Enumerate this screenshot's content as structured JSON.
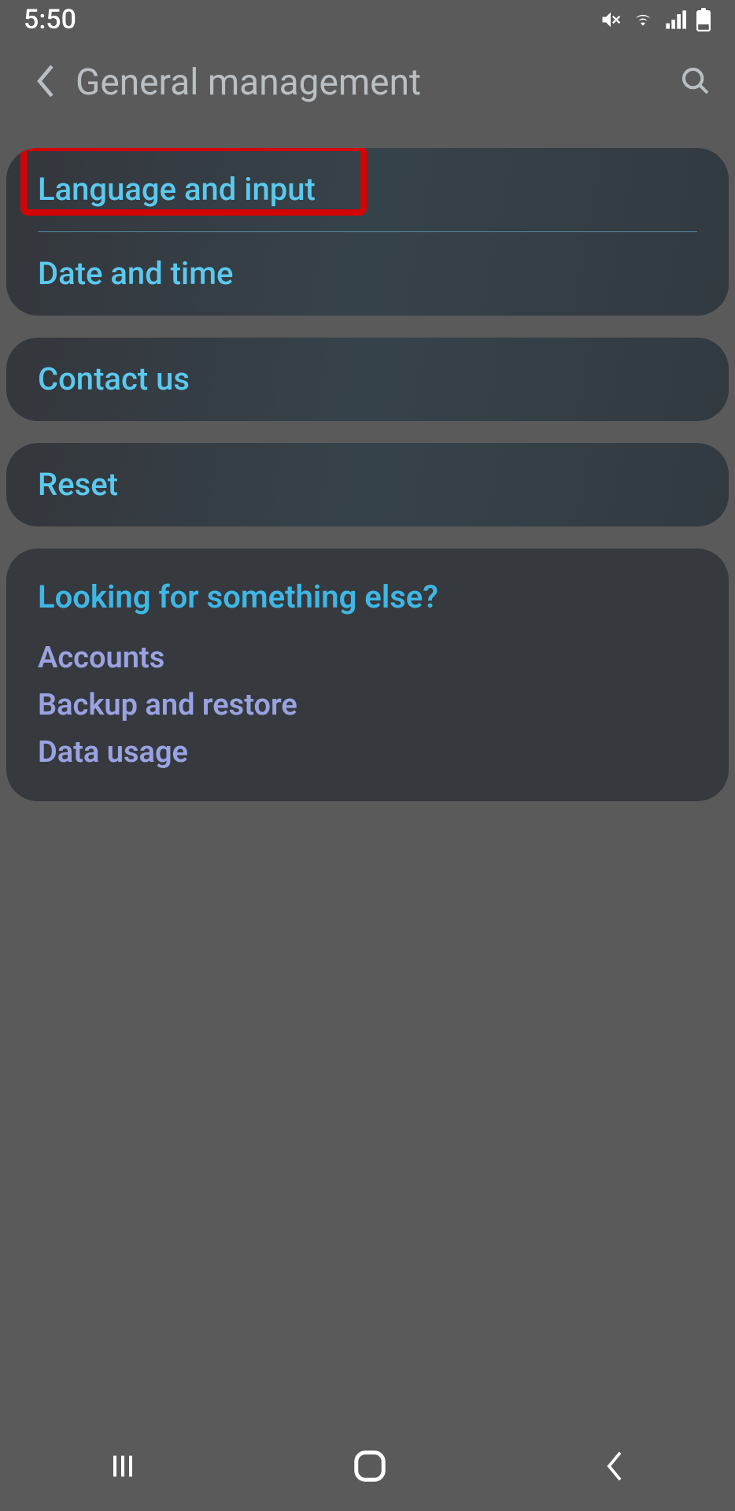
{
  "status": {
    "time": "5:50"
  },
  "header": {
    "title": "General management"
  },
  "groups": [
    {
      "items": [
        "Language and input",
        "Date and time"
      ],
      "gradient": true,
      "highlightIndex": 0
    },
    {
      "items": [
        "Contact us"
      ],
      "gradient": true
    },
    {
      "items": [
        "Reset"
      ],
      "gradient": true
    }
  ],
  "lookingFor": {
    "title": "Looking for something else?",
    "links": [
      "Accounts",
      "Backup and restore",
      "Data usage"
    ]
  }
}
